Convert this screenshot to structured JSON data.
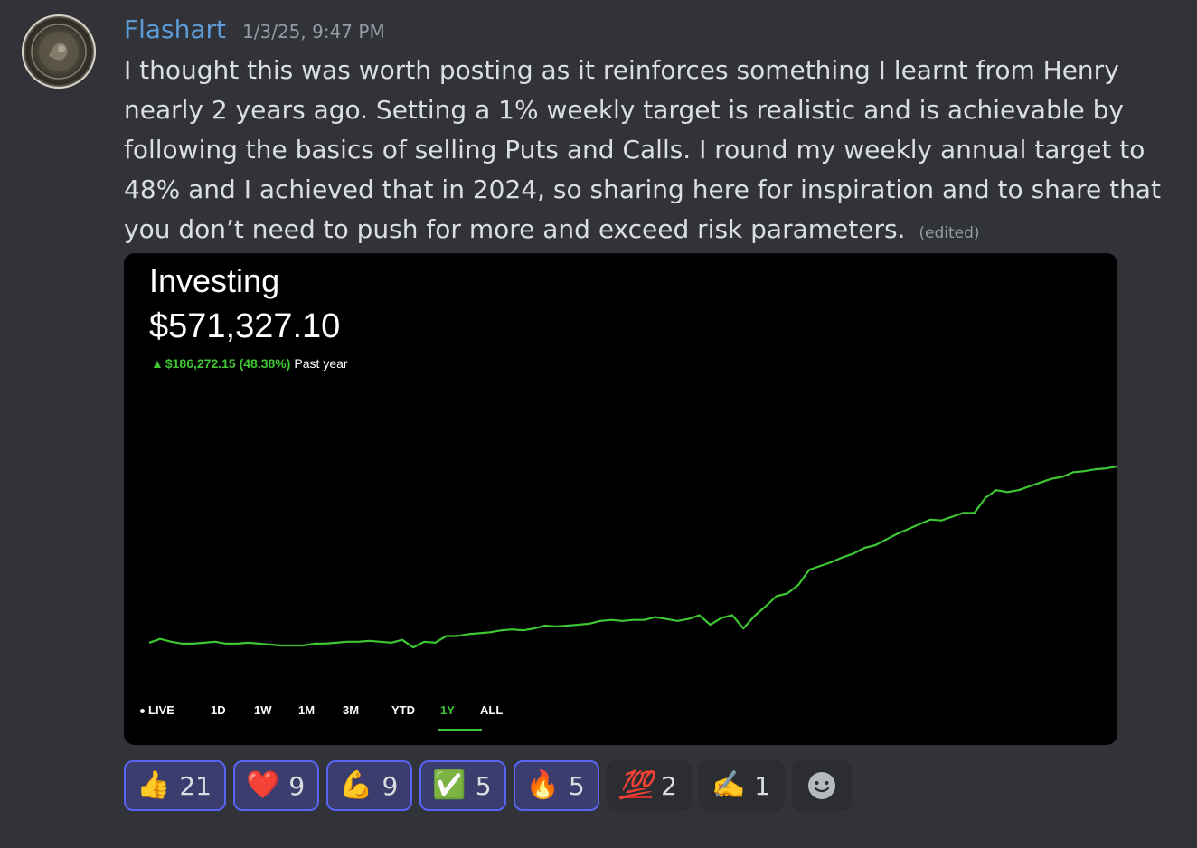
{
  "author": {
    "username": "Flashart",
    "timestamp": "1/3/25, 9:47 PM",
    "avatar_icon": "coin-avatar"
  },
  "message": {
    "text": "I thought this was worth posting as it reinforces something I learnt from Henry nearly 2 years ago. Setting a 1% weekly target is realistic and is achievable by following the basics of selling Puts and Calls. I round my weekly annual target to 48% and I achieved that in 2024, so sharing here for inspiration and to share that you don’t need to push for more and exceed risk parameters.",
    "edited_label": "(edited)"
  },
  "embed": {
    "title": "Investing",
    "value": "$571,327.10",
    "change_amount": "$186,272.15 (48.38%)",
    "change_period": "Past year",
    "tabs": [
      "LIVE",
      "1D",
      "1W",
      "1M",
      "3M",
      "YTD",
      "1Y",
      "ALL"
    ],
    "active_tab": "1Y",
    "colors": {
      "accent": "#3ec633",
      "background": "#000000"
    }
  },
  "chart_data": {
    "type": "line",
    "series": [
      {
        "values": [
          385,
          389,
          386,
          384,
          384,
          385,
          386,
          384,
          384,
          385,
          384,
          383,
          382,
          382,
          382,
          384,
          384,
          385,
          386,
          386,
          387,
          386,
          385,
          388,
          380,
          386,
          385,
          392,
          392,
          394,
          395,
          396,
          398,
          399,
          398,
          400,
          403,
          402,
          403,
          404,
          405,
          408,
          409,
          408,
          409,
          409,
          412,
          410,
          408,
          410,
          414,
          404,
          411,
          414,
          400,
          413,
          423,
          434,
          437,
          446,
          462,
          466,
          470,
          475,
          479,
          485,
          488,
          494,
          500,
          505,
          510,
          515,
          514,
          518,
          522,
          522,
          538,
          546,
          544,
          546,
          550,
          554,
          558,
          560,
          565,
          566,
          568,
          569,
          571
        ]
      }
    ]
  },
  "reactions": [
    {
      "emoji": "👍",
      "name": "thumbs-up",
      "count": "21",
      "me": true
    },
    {
      "emoji": "❤️",
      "name": "heart",
      "count": "9",
      "me": true
    },
    {
      "emoji": "💪",
      "name": "flexed-biceps",
      "count": "9",
      "me": true
    },
    {
      "emoji": "✅",
      "name": "check-mark",
      "count": "5",
      "me": true
    },
    {
      "emoji": "🔥",
      "name": "fire",
      "count": "5",
      "me": true
    },
    {
      "emoji": "💯",
      "name": "hundred-points",
      "count": "2",
      "me": false
    },
    {
      "emoji": "✍️",
      "name": "writing-hand",
      "count": "1",
      "me": false
    }
  ],
  "add_reaction_icon": "add-reaction-smile"
}
